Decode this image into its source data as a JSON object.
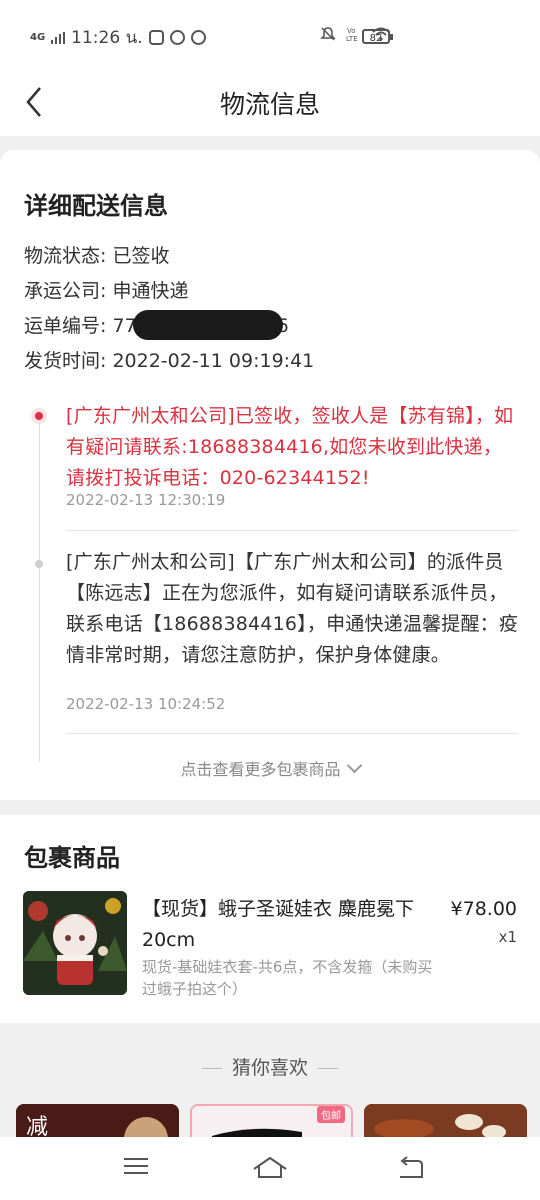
{
  "status_bar": {
    "network": "4G",
    "time": "11:26 น.",
    "battery": "82"
  },
  "nav": {
    "title": "物流信息"
  },
  "detail": {
    "section_title": "详细配送信息",
    "status_label": "物流状态: 已签收",
    "carrier_label": "承运公司: 申通快递",
    "waybill_prefix": "运单编号: 77",
    "waybill_suffix": "6",
    "ship_time_label": "发货时间: 2022-02-11 09:19:41"
  },
  "timeline": [
    {
      "text": "[广东广州太和公司]已签收，签收人是【苏有锦】，如有疑问请联系:18688384416,如您未收到此快递，请拨打投诉电话：020-62344152!",
      "time": "2022-02-13 12:30:19"
    },
    {
      "text": "[广东广州太和公司]【广东广州太和公司】的派件员【陈远志】正在为您派件，如有疑问请联系派件员，联系电话【18688384416】，申通快递温馨提醒：疫情非常时期，请您注意防护，保护身体健康。",
      "time": "2022-02-13 10:24:52"
    }
  ],
  "more_link": "点击查看更多包裹商品",
  "package": {
    "section_title": "包裹商品",
    "item": {
      "name": "【现货】蛾子圣诞娃衣 麋鹿冕下20cm",
      "price": "¥78.00",
      "quantity": "x1",
      "spec": "现货-基础娃衣套-共6点，不含发箍（未购买过蛾子拍这个）"
    }
  },
  "recommend": {
    "title": "猜你喜欢",
    "tag": "包邮"
  },
  "colors": {
    "accent_red": "#d9313f",
    "background": "#f0f0f0"
  }
}
